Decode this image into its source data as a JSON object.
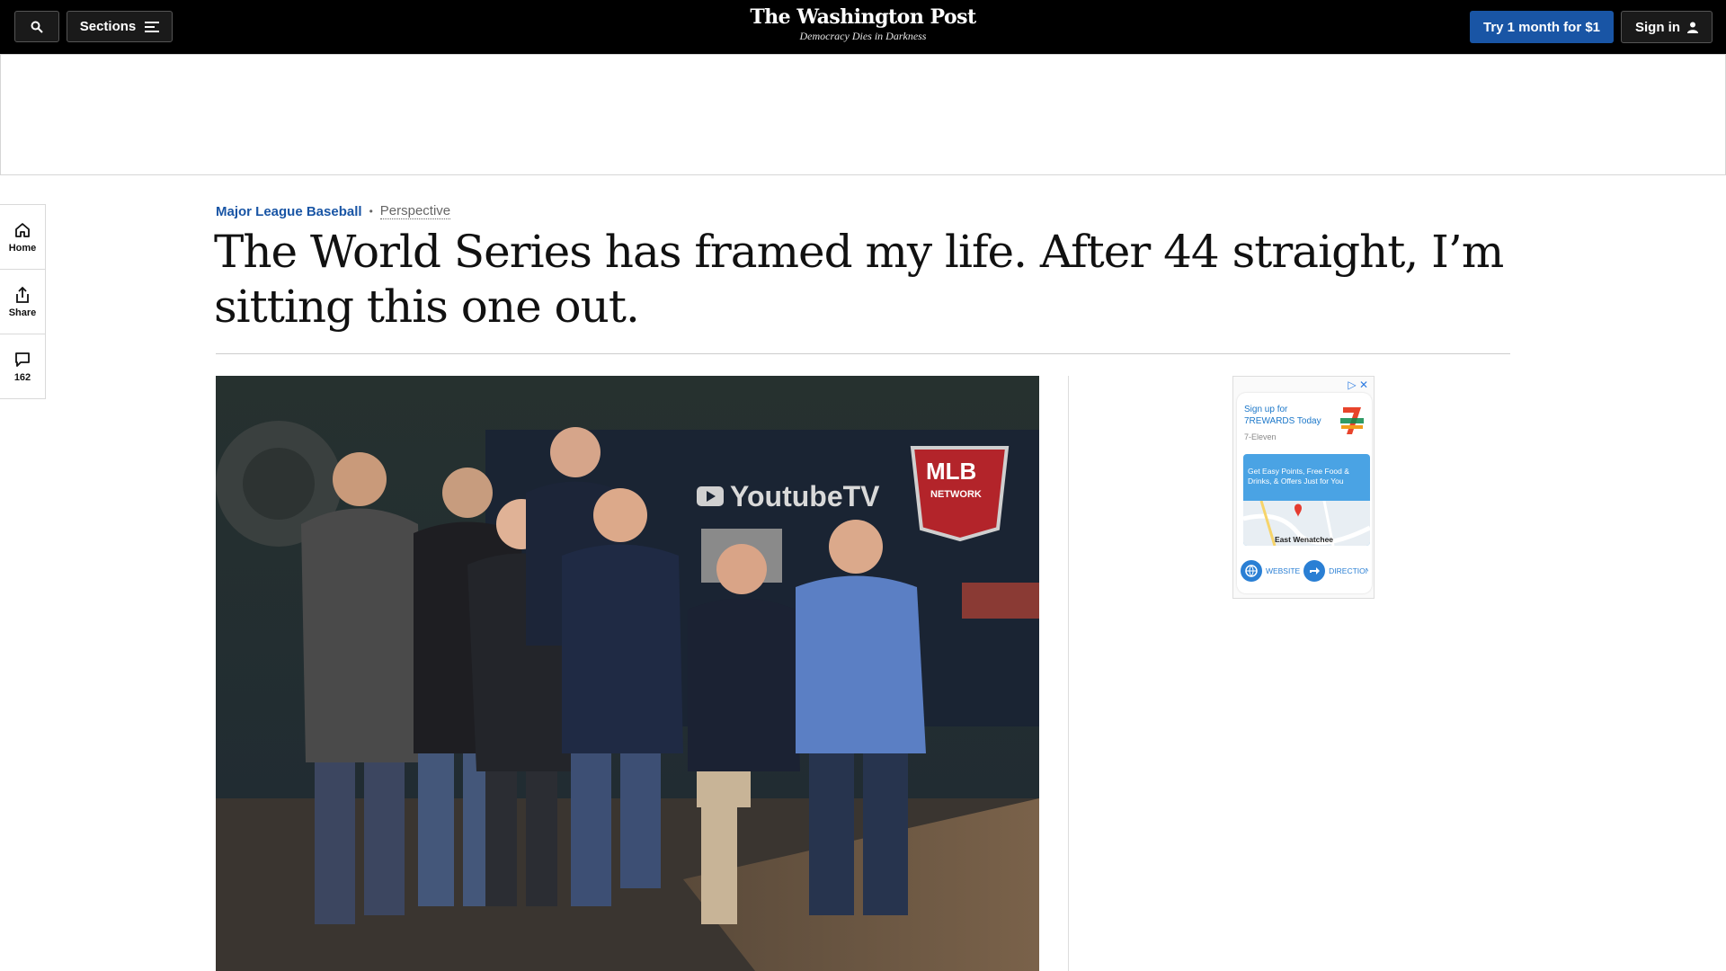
{
  "topbar": {
    "search_icon": "search-icon",
    "sections_label": "Sections",
    "sections_icon": "menu-icon",
    "logo": "The Washington Post",
    "tagline": "Democracy Dies in Darkness",
    "subscribe_label": "Try 1 month for $1",
    "signin_label": "Sign in",
    "signin_icon": "user-icon",
    "accent_color": "#1955a5"
  },
  "rail": {
    "items": [
      {
        "label": "Home",
        "icon": "home-icon"
      },
      {
        "label": "Share",
        "icon": "share-icon"
      },
      {
        "label": "162",
        "icon": "comment-icon"
      }
    ]
  },
  "article": {
    "section": "Major League Baseball",
    "label": "Perspective",
    "headline": "The World Series has framed my life. After 44 straight, I’m sitting this one out."
  },
  "photo": {
    "sign_text_1": "YoutubeTV",
    "sign_text_2": "MLB",
    "sign_text_3": "NETWORK"
  },
  "side_ad": {
    "signup": "Sign up for 7REWARDS Today",
    "brand": "7-Eleven",
    "promo": "Get Easy Points, Free Food & Drinks, & Offers Just for You",
    "map_label": "East Wenatchee",
    "website_label": "WEBSITE",
    "directions_label": "DIRECTIONS"
  }
}
